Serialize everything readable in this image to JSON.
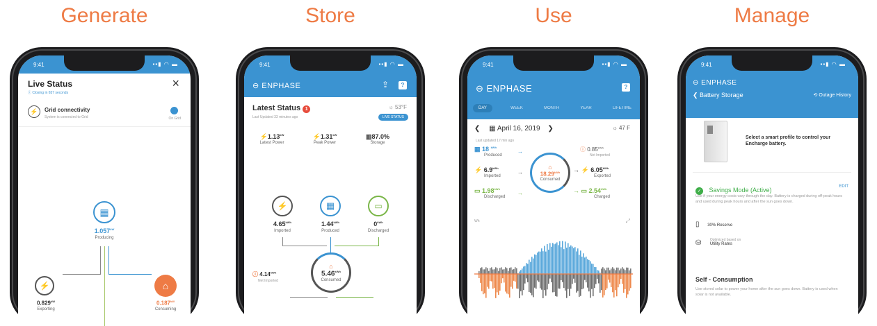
{
  "colors": {
    "accent": "#ee7b45",
    "blue": "#3b93d1",
    "green": "#7ab648",
    "gray": "#6b6b6b"
  },
  "columns": [
    {
      "heading": "Generate"
    },
    {
      "heading": "Store"
    },
    {
      "heading": "Use"
    },
    {
      "heading": "Manage"
    }
  ],
  "status_time": "9:41",
  "generate": {
    "title": "Live Status",
    "close": "×",
    "subtitle": "Closing in 657 seconds",
    "grid_title": "Grid connectivity",
    "grid_sub": "System is connected to Grid",
    "grid_toggle_label": "On Grid",
    "producing_value": "1.057",
    "producing_unit": "kW",
    "producing_label": "Producing",
    "exporting_value": "0.829",
    "exporting_unit": "kW",
    "exporting_label": "Exporting",
    "consuming_value": "0.187",
    "consuming_unit": "kW",
    "consuming_label": "Consuming"
  },
  "store": {
    "brand": "ENPHASE",
    "title": "Latest Status",
    "badge": "1",
    "updated": "Last Updated 33 minutes ago",
    "temp": "53°F",
    "live_status": "LIVE STATUS",
    "stats": [
      {
        "value": "1.13",
        "unit": "kW",
        "label": "Latest Power"
      },
      {
        "value": "1.31",
        "unit": "kW",
        "label": "Peak Power"
      },
      {
        "value": "87.0%",
        "unit": "",
        "label": "Storage"
      }
    ],
    "imported_value": "4.65",
    "imported_unit": "kWh",
    "imported_label": "Imported",
    "produced_value": "1.44",
    "produced_unit": "kWh",
    "produced_label": "Produced",
    "discharged_value": "0",
    "discharged_unit": "kWh",
    "discharged_label": "Discharged",
    "net_value": "4.14",
    "net_unit": "kWh",
    "net_label": "Net Imported",
    "consumed_value": "5.46",
    "consumed_unit": "kWh",
    "consumed_label": "Consumed"
  },
  "use": {
    "brand": "ENPHASE",
    "tabs": [
      "DAY",
      "WEEK",
      "MONTH",
      "YEAR",
      "LIFETIME"
    ],
    "date": "April 16, 2019",
    "temp": "47 F",
    "updated": "Last updated 17 min ago",
    "produced_value": "18",
    "produced_unit": "kWh",
    "produced_label": "Produced",
    "imported_value": "6.9",
    "imported_unit": "kWh",
    "imported_label": "Imported",
    "discharged_value": "1.98",
    "discharged_unit": "kWh",
    "discharged_label": "Discharged",
    "consumed_value": "18.29",
    "consumed_unit": "kWh",
    "consumed_label": "Consumed",
    "net_value": "0.85",
    "net_unit": "kWh",
    "net_label": "Net Imported",
    "exported_value": "6.05",
    "exported_unit": "kWh",
    "exported_label": "Exported",
    "charged_value": "2.54",
    "charged_unit": "kWh",
    "charged_label": "Charged",
    "chart_unit": "Wh"
  },
  "manage": {
    "brand": "ENPHASE",
    "back_label": "Battery Storage",
    "history_label": "Outage History",
    "intro": "Select a smart profile to control your Encharge battery.",
    "mode_title": "Savings Mode (Active)",
    "edit": "EDIT",
    "mode_desc": "Use if your energy costs vary through the day. Battery is charged during off-peak hours and used during peak hours and after the sun goes down.",
    "reserve": "30% Reserve",
    "optimized_small": "Optimized based on",
    "optimized": "Utility Rates",
    "self_title": "Self - Consumption",
    "self_desc": "Use stored solar to power your home after the sun goes down. Battery is used when solar is not available."
  }
}
